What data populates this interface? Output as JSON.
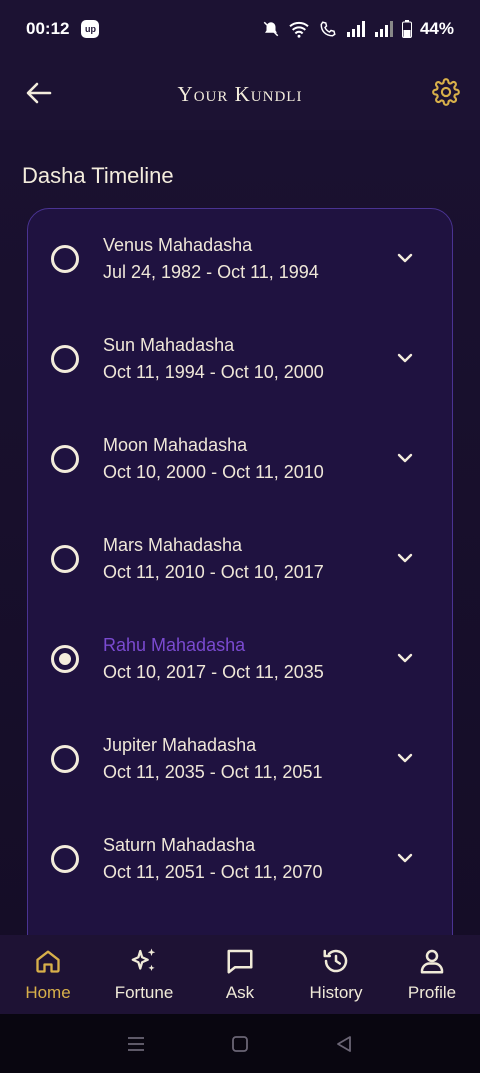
{
  "status_bar": {
    "time": "00:12",
    "app_badge": "up",
    "battery": "44%"
  },
  "app_bar": {
    "title": "Your Kundli"
  },
  "section": {
    "title": "Dasha Timeline"
  },
  "dashas": [
    {
      "name": "Venus Mahadasha",
      "dates": "Jul 24, 1982 - Oct 11, 1994",
      "selected": false
    },
    {
      "name": "Sun Mahadasha",
      "dates": "Oct 11, 1994 - Oct 10, 2000",
      "selected": false
    },
    {
      "name": "Moon Mahadasha",
      "dates": "Oct 10, 2000 - Oct 11, 2010",
      "selected": false
    },
    {
      "name": "Mars Mahadasha",
      "dates": "Oct 11, 2010 - Oct 10, 2017",
      "selected": false
    },
    {
      "name": "Rahu Mahadasha",
      "dates": "Oct 10, 2017 - Oct 11, 2035",
      "selected": true
    },
    {
      "name": "Jupiter Mahadasha",
      "dates": "Oct 11, 2035 - Oct 11, 2051",
      "selected": false
    },
    {
      "name": "Saturn Mahadasha",
      "dates": "Oct 11, 2051 - Oct 11, 2070",
      "selected": false
    }
  ],
  "bottom_nav": [
    {
      "label": "Home",
      "icon": "home-icon",
      "active": true
    },
    {
      "label": "Fortune",
      "icon": "sparkles-icon",
      "active": false
    },
    {
      "label": "Ask",
      "icon": "chat-icon",
      "active": false
    },
    {
      "label": "History",
      "icon": "history-icon",
      "active": false
    },
    {
      "label": "Profile",
      "icon": "person-icon",
      "active": false
    }
  ],
  "colors": {
    "background": "#120a22",
    "card": "#1f1240",
    "accent_gold": "#d8b04a",
    "accent_purple": "#7a4ad0",
    "text": "#f3ecdc"
  }
}
